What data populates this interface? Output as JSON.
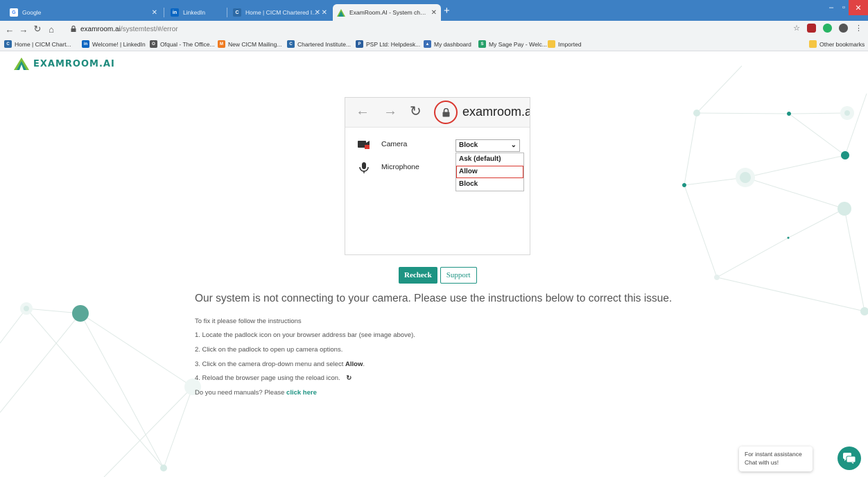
{
  "browser": {
    "tabs": [
      {
        "title": "Google",
        "active": false
      },
      {
        "title": "LinkedIn",
        "active": false
      },
      {
        "title": "Home | CICM Chartered Institute",
        "active": false
      },
      {
        "title": "ExamRoom.AI - System check",
        "active": true
      }
    ],
    "new_tab": "+",
    "window_controls": {
      "minimize": "–",
      "maximize": "▫",
      "close": "✕"
    },
    "url": {
      "host": "examroom.ai",
      "path": "/systemtest/#/error"
    },
    "bookmarks": [
      "Home | CICM Chart...",
      "Welcome! | LinkedIn",
      "Ofqual - The Office...",
      "New CICM Mailing...",
      "Chartered Institute...",
      "PSP Ltd: Helpdesk...",
      "My dashboard",
      "My Sage Pay - Welc...",
      "Imported"
    ],
    "other_bookmarks": "Other bookmarks"
  },
  "page": {
    "logo": "EXAMROOM.AI",
    "demo": {
      "host": "examroom.ai",
      "camera_label": "Camera",
      "microphone_label": "Microphone",
      "select_value": "Block",
      "options": [
        "Ask (default)",
        "Allow",
        "Block"
      ],
      "highlighted_option": "Allow"
    },
    "buttons": {
      "recheck": "Recheck",
      "support": "Support"
    },
    "headline": "Our system is not connecting to your camera. Please use the instructions below to correct this issue.",
    "instructions": {
      "intro": "To fix it please follow the instructions",
      "step1": "1. Locate the padlock icon on your browser address bar (see image above).",
      "step2": "2. Click on the padlock to open up camera options.",
      "step3_pre": "3. Click on the camera drop-down menu and select ",
      "step3_bold": "Allow",
      "step3_post": ".",
      "step4": "4. Reload the browser page using the reload icon.",
      "manuals_pre": "Do you need manuals? Please ",
      "manuals_link": "click here"
    },
    "chat": {
      "line1": "For instant assistance",
      "line2": "Chat with us!"
    }
  },
  "colors": {
    "brand": "#1e9483",
    "highlight": "#d9372f",
    "tabstrip": "#3d80c4"
  }
}
